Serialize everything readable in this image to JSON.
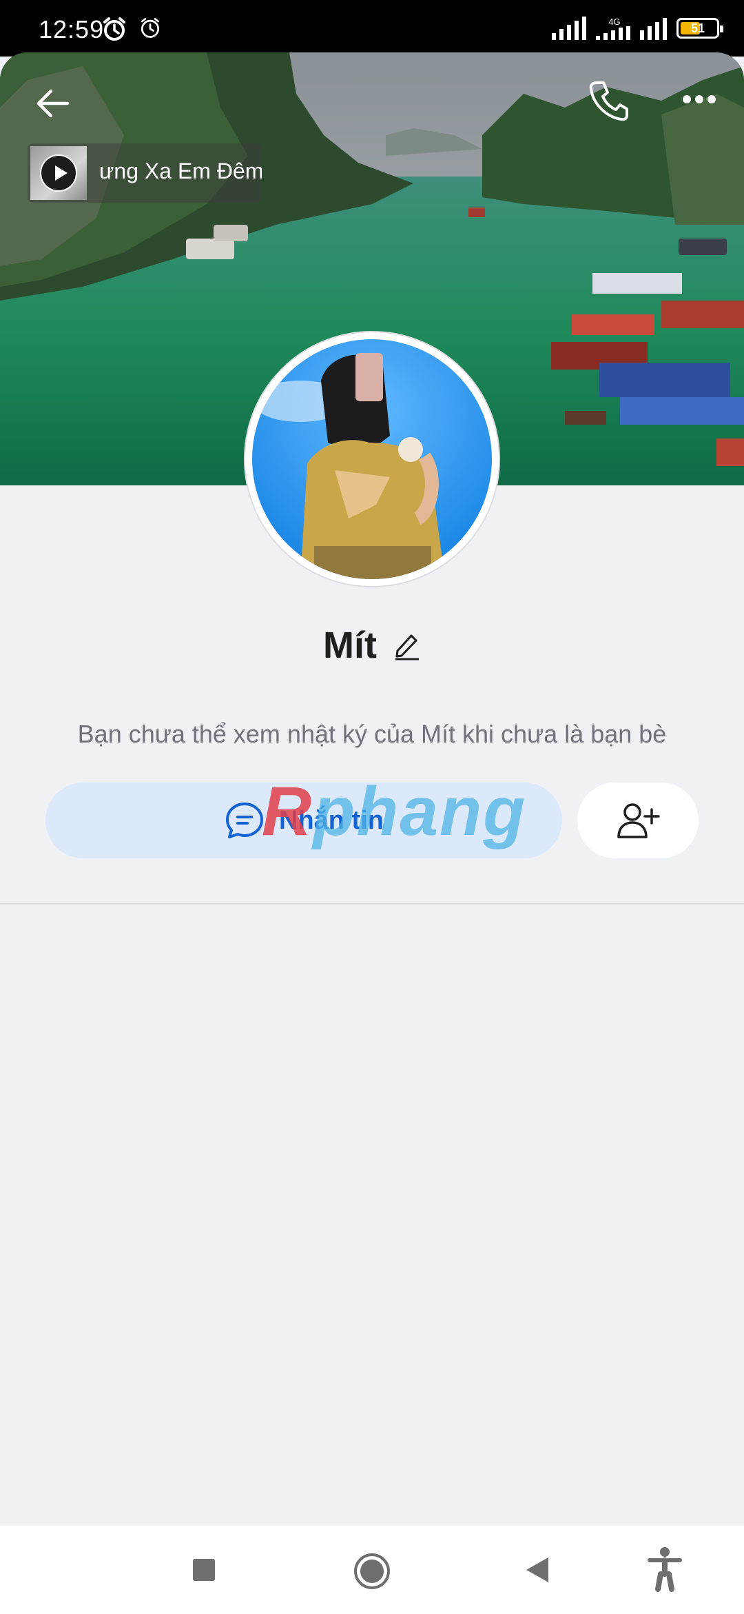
{
  "status_bar": {
    "time": "12:59",
    "network": "4G",
    "battery": "51"
  },
  "cover": {
    "music_title": "ưng Xa Em Đêm"
  },
  "profile": {
    "name": "Mít",
    "note": "Bạn chưa thể xem nhật ký của Mít khi chưa là bạn bè"
  },
  "actions": {
    "message_label": "Nhắn tin"
  },
  "watermark": {
    "part1": "R",
    "part2": "phang"
  },
  "icons": [
    "back-arrow-icon",
    "phone-icon",
    "more-icon",
    "play-icon",
    "edit-pencil-icon",
    "chat-bubble-icon",
    "add-friend-icon",
    "alarm-icon",
    "accessibility-icon"
  ],
  "colors": {
    "accent": "#1463d4",
    "button_bg": "#dce9fb",
    "page_bg": "#f0f1f5"
  }
}
